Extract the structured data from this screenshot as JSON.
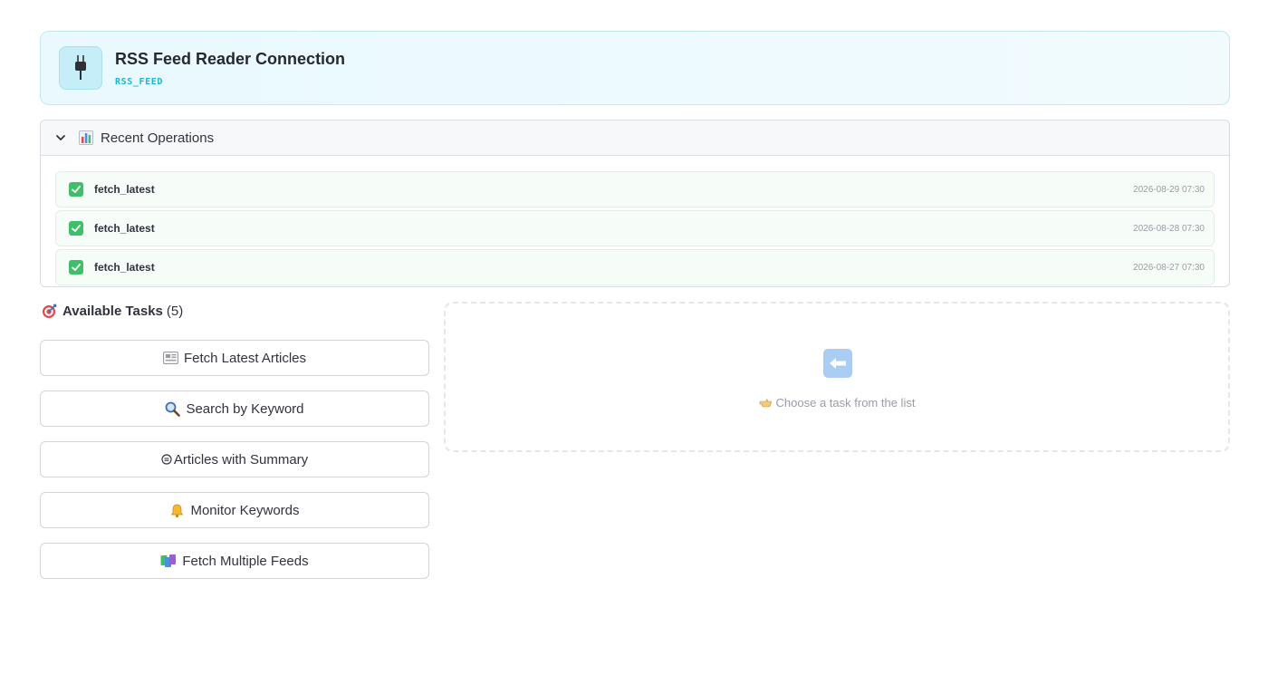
{
  "header": {
    "title": "RSS Feed Reader Connection",
    "code": "RSS_FEED",
    "icon": "plug-icon"
  },
  "recent_operations": {
    "title": "Recent Operations",
    "icon": "bar-chart-icon",
    "items": [
      {
        "name": "fetch_latest",
        "time": "2026-08-29 07:30",
        "status": "success"
      },
      {
        "name": "fetch_latest",
        "time": "2026-08-28 07:30",
        "status": "success"
      },
      {
        "name": "fetch_latest",
        "time": "2026-08-27 07:30",
        "status": "success"
      }
    ]
  },
  "tasks": {
    "heading": "Available Tasks",
    "count": "(5)",
    "items": [
      {
        "label": "Fetch Latest Articles",
        "icon": "newspaper-icon"
      },
      {
        "label": "Search by Keyword",
        "icon": "magnifier-icon"
      },
      {
        "label": "Articles with Summary",
        "icon": "summary-icon"
      },
      {
        "label": "Monitor Keywords",
        "icon": "bell-icon"
      },
      {
        "label": "Fetch Multiple Feeds",
        "icon": "books-icon"
      }
    ]
  },
  "placeholder": {
    "text": "Choose a task from the list",
    "icon": "left-arrow-icon"
  },
  "colors": {
    "accent": "#19b7d2",
    "success": "#3fbf6a",
    "header_bg": "#e9f9fd"
  }
}
